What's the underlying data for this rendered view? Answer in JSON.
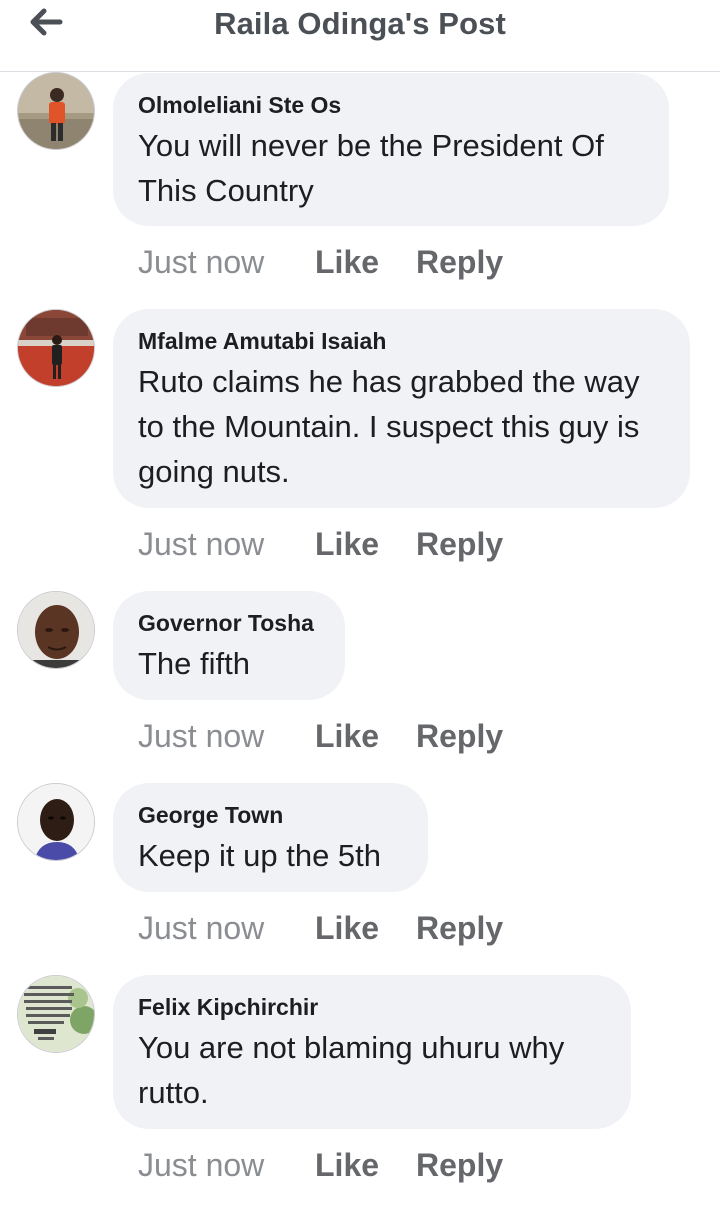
{
  "header": {
    "title": "Raila Odinga's Post",
    "back_icon": "arrow-left-icon"
  },
  "comments": [
    {
      "author": "Olmoleliani Ste Os",
      "text": "You will never be the President Of This Country",
      "time": "Just now",
      "like_label": "Like",
      "reply_label": "Reply"
    },
    {
      "author": "Mfalme Amutabi Isaiah",
      "text": "Ruto claims he has grabbed the way to the Mountain. I suspect this guy is going nuts.",
      "time": "Just now",
      "like_label": "Like",
      "reply_label": "Reply"
    },
    {
      "author": "Governor Tosha",
      "text": "The fifth",
      "time": "Just now",
      "like_label": "Like",
      "reply_label": "Reply"
    },
    {
      "author": "George Town",
      "text": "Keep it up the 5th",
      "time": "Just now",
      "like_label": "Like",
      "reply_label": "Reply"
    },
    {
      "author": "Felix Kipchirchir",
      "text": "You are not blaming uhuru why rutto.",
      "time": "Just now",
      "like_label": "Like",
      "reply_label": "Reply"
    }
  ]
}
